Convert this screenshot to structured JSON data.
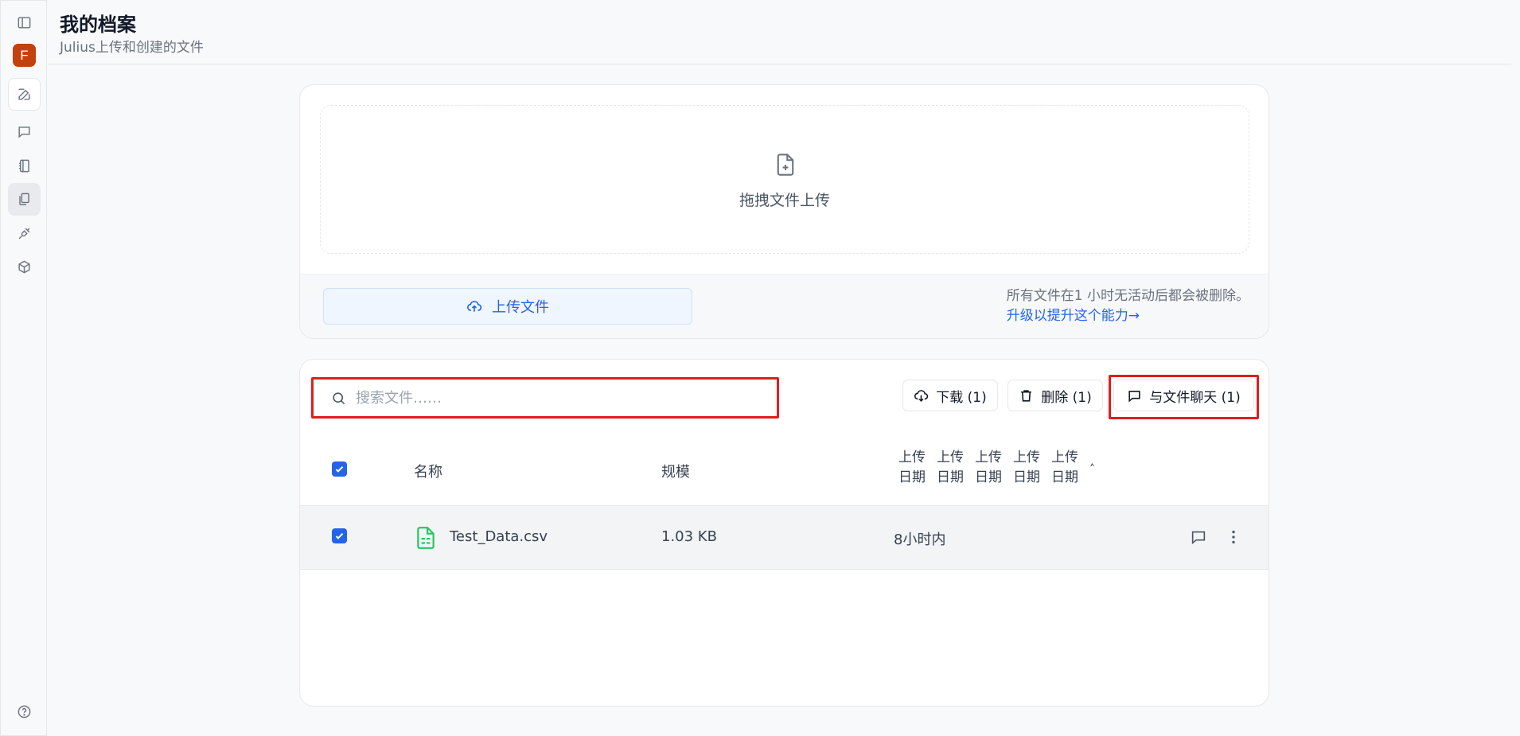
{
  "sidebar": {
    "avatar_initial": "F",
    "items": [
      {
        "name": "toggle-sidebar",
        "icon": "panel-left-icon"
      },
      {
        "name": "new-chat",
        "icon": "edit-icon"
      },
      {
        "name": "chats",
        "icon": "message-square-icon"
      },
      {
        "name": "notebooks",
        "icon": "notebook-icon"
      },
      {
        "name": "files",
        "icon": "files-icon",
        "active": true
      },
      {
        "name": "integrations",
        "icon": "plug-icon"
      },
      {
        "name": "packages",
        "icon": "box-icon"
      },
      {
        "name": "help",
        "icon": "help-circle-icon"
      }
    ]
  },
  "header": {
    "title": "我的档案",
    "subtitle": "Julius上传和创建的文件"
  },
  "upload": {
    "dropzone_label": "拖拽文件上传",
    "button_label": "上传文件",
    "notice": "所有文件在1 小时无活动后都会被删除。",
    "upgrade_link": "升级以提升这个能力→"
  },
  "files": {
    "search_placeholder": "搜索文件……",
    "download_label": "下载 (1)",
    "delete_label": "删除 (1)",
    "chat_label": "与文件聊天 (1)",
    "columns": {
      "name": "名称",
      "size": "规模",
      "date_parts": [
        "上传",
        "日期"
      ],
      "sort_indicator": "˄"
    },
    "rows": [
      {
        "name": "Test_Data.csv",
        "size": "1.03 KB",
        "uploaded": "8小时内",
        "selected": true
      }
    ]
  },
  "colors": {
    "accent": "#2563eb",
    "highlight": "#e11d1d",
    "avatar": "#c2410c",
    "csv_icon": "#22c55e"
  }
}
